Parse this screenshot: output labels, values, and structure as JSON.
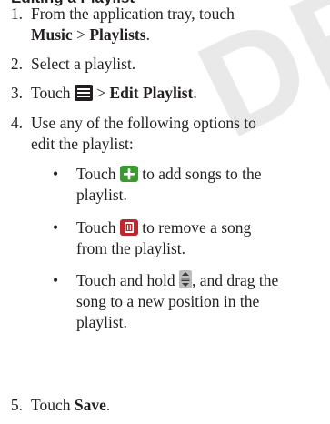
{
  "watermark": "DRAFT",
  "heading_fragment": "Editing a Playlist",
  "steps": [
    {
      "number": "1.",
      "text_a": "From the application tray, touch",
      "bold_a": "Music",
      "sep": " > ",
      "bold_b": "Playlists",
      "end": "."
    },
    {
      "number": "2.",
      "text": "Select a playlist."
    },
    {
      "number": "3.",
      "text_a": "Touch ",
      "icon": "menu-icon",
      "sep": " > ",
      "bold": "Edit Playlist",
      "end": "."
    },
    {
      "number": "4.",
      "line1": "Use any of the following options to",
      "line2": "edit the playlist:"
    },
    {
      "number": "5.",
      "text_a": "Touch ",
      "bold": "Save",
      "end": "."
    }
  ],
  "options": [
    {
      "bullet": "•",
      "pre": "Touch ",
      "icon": "add-icon",
      "post1": " to add songs to the",
      "post2": "playlist."
    },
    {
      "bullet": "•",
      "pre": "Touch ",
      "icon": "trash-icon",
      "post1": " to remove a song",
      "post2": "from the playlist."
    },
    {
      "bullet": "•",
      "pre": "Touch and hold ",
      "icon": "reorder-icon",
      "post1": ", and drag the",
      "post2": "song to a new position in the",
      "post3": "playlist."
    }
  ],
  "colors": {
    "text": "#231f20",
    "add_icon": "#3a9a2f",
    "trash_icon": "#c0272d",
    "watermark": "#e9e9e9"
  }
}
